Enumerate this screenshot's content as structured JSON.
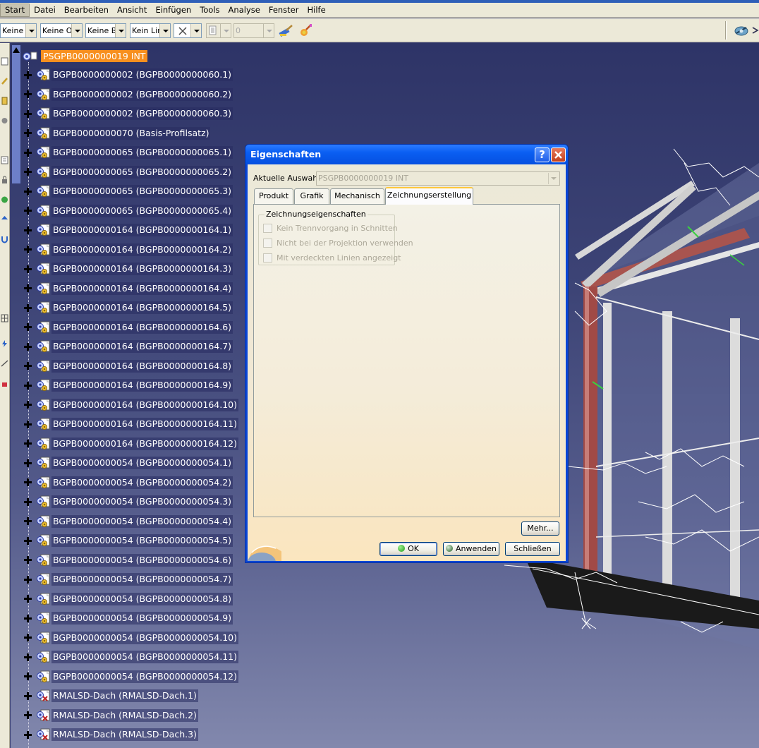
{
  "menubar": {
    "items": [
      {
        "label": "Start",
        "active": true
      },
      {
        "label": "Datei"
      },
      {
        "label": "Bearbeiten"
      },
      {
        "label": "Ansicht"
      },
      {
        "label": "Einfügen"
      },
      {
        "label": "Tools"
      },
      {
        "label": "Analyse"
      },
      {
        "label": "Fenster"
      },
      {
        "label": "Hilfe"
      }
    ]
  },
  "toolbar": {
    "fill_color": "Keine F",
    "transparency": "Keine O",
    "line_thickness": "Keine B",
    "line_type": "Kein Lin",
    "point_type": "",
    "layer": "",
    "layer_value": "0"
  },
  "tree": {
    "root": "PSGPB0000000019 INT",
    "items": [
      "BGPB0000000002 (BGPB0000000060.1)",
      "BGPB0000000002 (BGPB0000000060.2)",
      "BGPB0000000002 (BGPB0000000060.3)",
      "BGPB0000000070 (Basis-Profilsatz)",
      "BGPB0000000065 (BGPB0000000065.1)",
      "BGPB0000000065 (BGPB0000000065.2)",
      "BGPB0000000065 (BGPB0000000065.3)",
      "BGPB0000000065 (BGPB0000000065.4)",
      "BGPB0000000164 (BGPB0000000164.1)",
      "BGPB0000000164 (BGPB0000000164.2)",
      "BGPB0000000164 (BGPB0000000164.3)",
      "BGPB0000000164 (BGPB0000000164.4)",
      "BGPB0000000164 (BGPB0000000164.5)",
      "BGPB0000000164 (BGPB0000000164.6)",
      "BGPB0000000164 (BGPB0000000164.7)",
      "BGPB0000000164 (BGPB0000000164.8)",
      "BGPB0000000164 (BGPB0000000164.9)",
      "BGPB0000000164 (BGPB0000000164.10)",
      "BGPB0000000164 (BGPB0000000164.11)",
      "BGPB0000000164 (BGPB0000000164.12)",
      "BGPB0000000054 (BGPB0000000054.1)",
      "BGPB0000000054 (BGPB0000000054.2)",
      "BGPB0000000054 (BGPB0000000054.3)",
      "BGPB0000000054 (BGPB0000000054.4)",
      "BGPB0000000054 (BGPB0000000054.5)",
      "BGPB0000000054 (BGPB0000000054.6)",
      "BGPB0000000054 (BGPB0000000054.7)",
      "BGPB0000000054 (BGPB0000000054.8)",
      "BGPB0000000054 (BGPB0000000054.9)",
      "BGPB0000000054 (BGPB0000000054.10)",
      "BGPB0000000054 (BGPB0000000054.11)",
      "BGPB0000000054 (BGPB0000000054.12)",
      "RMALSD-Dach (RMALSD-Dach.1)",
      "RMALSD-Dach (RMALSD-Dach.2)",
      "RMALSD-Dach (RMALSD-Dach.3)"
    ]
  },
  "dialog": {
    "title": "Eigenschaften",
    "help_glyph": "?",
    "current_selection_label": "Aktuelle Auswahl:",
    "current_selection_value": "PSGPB0000000019 INT",
    "tabs": [
      {
        "label": "Produkt"
      },
      {
        "label": "Grafik"
      },
      {
        "label": "Mechanisch"
      },
      {
        "label": "Zeichnungserstellung",
        "active": true
      }
    ],
    "group_title": "Zeichnungseigenschaften",
    "checkboxes": [
      {
        "label": "Kein Trennvorgang in Schnitten",
        "checked": false,
        "enabled": false
      },
      {
        "label": "Nicht bei der Projektion verwenden",
        "checked": false,
        "enabled": false
      },
      {
        "label": "Mit verdeckten Linien angezeigt",
        "checked": false,
        "enabled": false
      }
    ],
    "more_button": "Mehr...",
    "ok_button": "OK",
    "apply_button": "Anwenden",
    "close_button": "Schließen"
  },
  "colors": {
    "selection": "#f78f1e",
    "dialog_titlebar": "#0a5ef2",
    "viewport_top": "#2e3467",
    "viewport_bottom": "#8288ad"
  }
}
